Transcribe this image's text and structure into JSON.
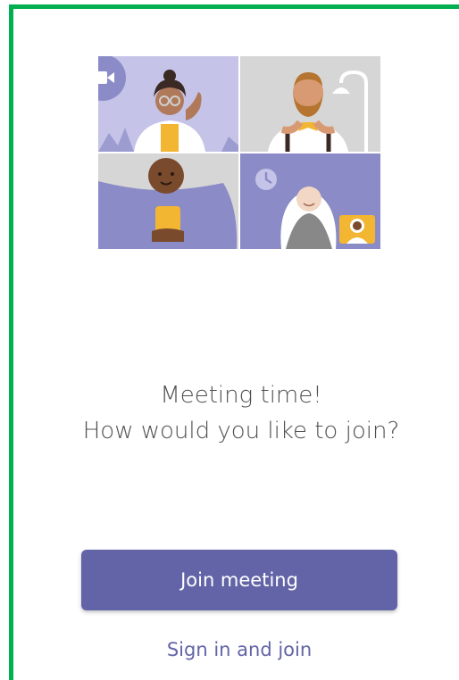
{
  "colors": {
    "frame": "#00b050",
    "brand": "#6264a7",
    "panel_lavender": "#c5c4e8",
    "panel_gray": "#d6d6d6",
    "panel_purple": "#8b8cc7",
    "text_primary": "#505050"
  },
  "illustration": {
    "icons": [
      "video-camera-icon",
      "clock-icon",
      "person-thumbnail-icon",
      "lamp-icon"
    ]
  },
  "prompt": {
    "line1": "Meeting time!",
    "line2": "How would you like to join?"
  },
  "actions": {
    "join_label": "Join meeting",
    "signin_label": "Sign in and join"
  }
}
